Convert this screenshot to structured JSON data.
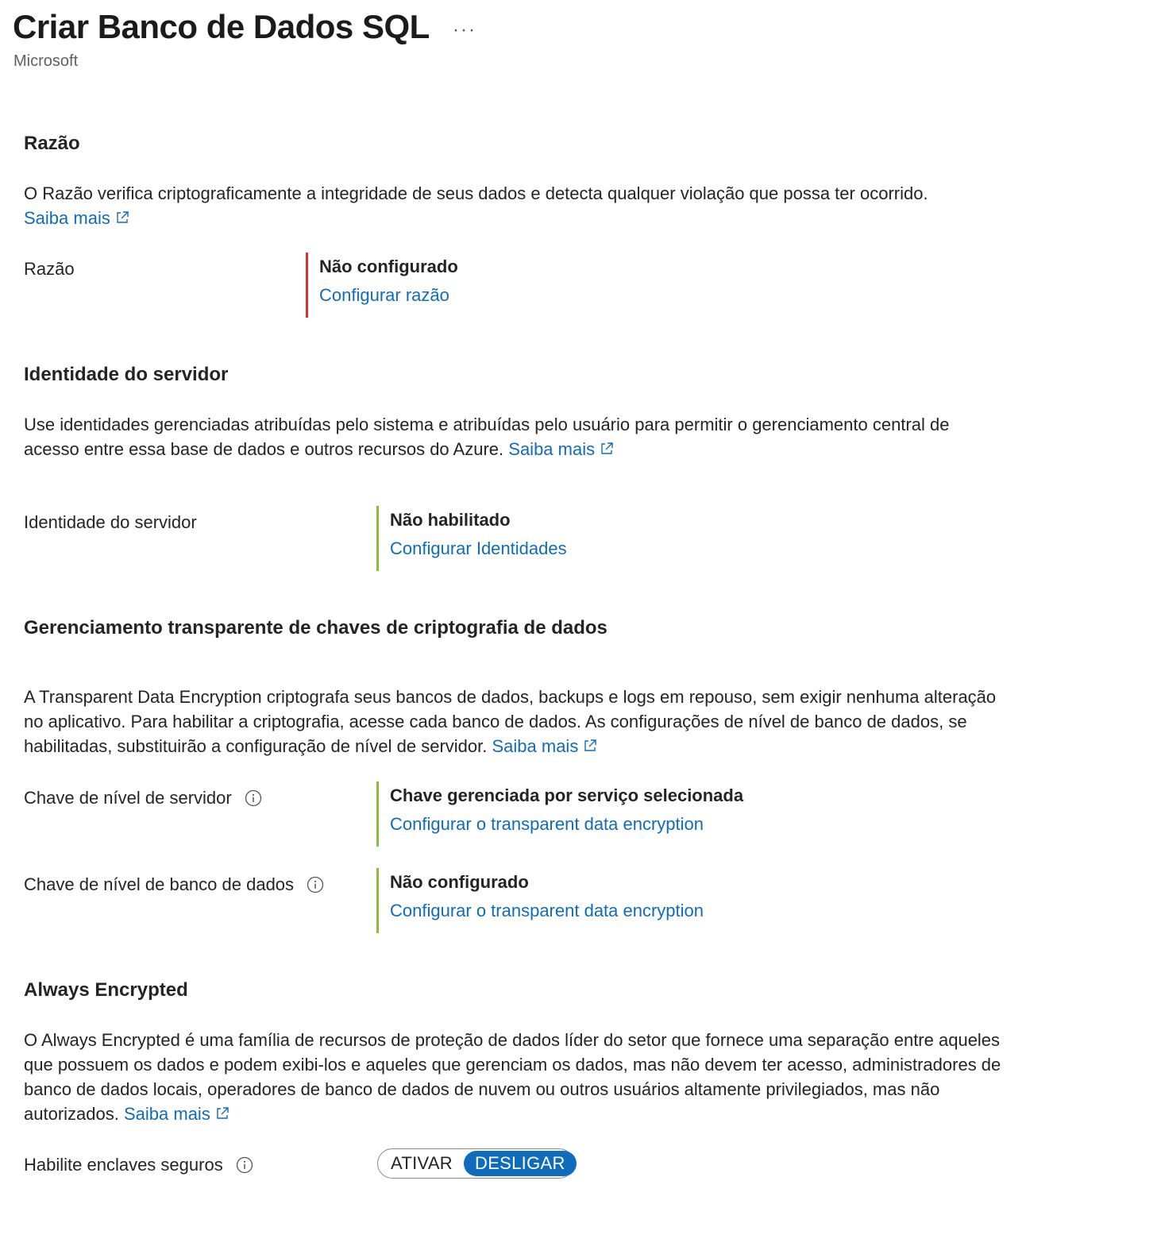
{
  "header": {
    "title": "Criar Banco de Dados SQL",
    "more_label": "···",
    "subtitle": "Microsoft"
  },
  "learn_more": "Saiba mais",
  "ledger": {
    "heading": "Razão",
    "description": "O Razão verifica criptograficamente a integridade de seus dados e detecta qualquer violação que possa ter ocorrido.",
    "row_label": "Razão",
    "status": "Não configurado",
    "action": "Configurar razão"
  },
  "identity": {
    "heading": "Identidade do servidor",
    "description": "Use identidades gerenciadas atribuídas pelo sistema e atribuídas pelo usuário para permitir o gerenciamento central de acesso entre essa base de dados e outros recursos do Azure.",
    "row_label": "Identidade do servidor",
    "status": "Não habilitado",
    "action": "Configurar Identidades"
  },
  "tde": {
    "heading": "Gerenciamento transparente de chaves de criptografia de dados",
    "description": "A Transparent Data Encryption criptografa seus bancos de dados, backups e logs em repouso, sem exigir nenhuma alteração no aplicativo. Para habilitar a criptografia, acesse cada banco de dados. As configurações de nível de banco de dados, se habilitadas, substituirão a configuração de nível de servidor.",
    "server_key": {
      "label": "Chave de nível de servidor",
      "status": "Chave gerenciada por serviço selecionada",
      "action": "Configurar o transparent data encryption"
    },
    "db_key": {
      "label": "Chave de nível de banco de dados",
      "status": "Não configurado",
      "action": "Configurar o transparent data encryption"
    }
  },
  "always_encrypted": {
    "heading": "Always Encrypted",
    "description": "O Always Encrypted é uma família de recursos de proteção de dados líder do setor que fornece uma separação entre aqueles que possuem os dados e podem exibi-los e aqueles que gerenciam os dados, mas não devem ter acesso, administradores de banco de dados locais, operadores de banco de dados de nuvem ou outros usuários altamente privilegiados, mas não autorizados.",
    "row_label": "Habilite enclaves seguros",
    "toggle_on": "ATIVAR",
    "toggle_off": "DESLIGAR",
    "selected": "DESLIGAR"
  },
  "colors": {
    "link": "#0f6cbd",
    "status_ok": "#8cbd3a",
    "status_error": "#d13438"
  }
}
